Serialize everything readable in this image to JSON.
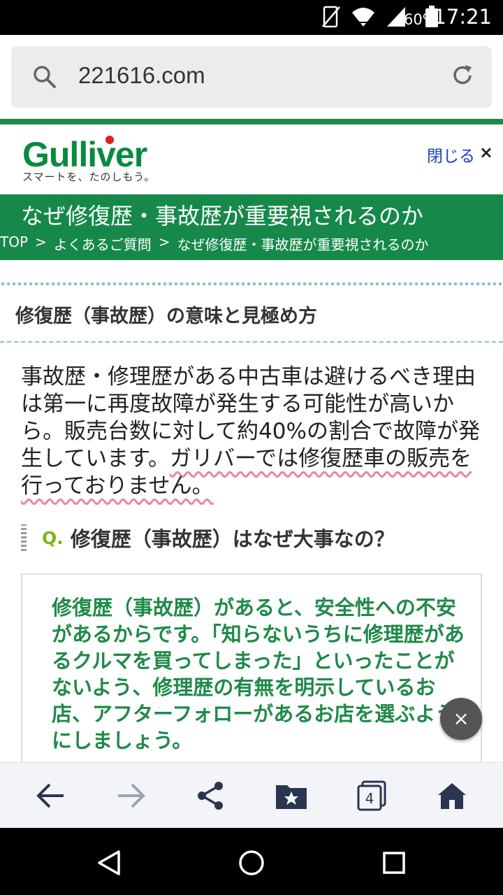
{
  "status_bar": {
    "battery": "60%",
    "time": "17:21"
  },
  "url_bar": {
    "url": "221616.com"
  },
  "site_header": {
    "logo": "Gulliver",
    "tagline": "スマートを、たのしもう。",
    "close_label": "閉じる",
    "close_symbol": "×"
  },
  "title_band": {
    "title": "なぜ修復歴・事故歴が重要視されるのか",
    "breadcrumb": [
      "TOP",
      ">",
      "よくあるご質問",
      ">",
      "なぜ修復歴・事故歴が重要視されるのか"
    ]
  },
  "section": {
    "heading": "修復歴（事故歴）の意味と見極め方",
    "body_plain": "事故歴・修理歴がある中古車は避けるべき理由は第一に再度故障が発生する可能性が高いから。販売台数に対して約40%の割合で故障が発生しています。",
    "body_highlight": "ガリバーでは修復歴車の販売を行っておりません。"
  },
  "faq": {
    "q_mark": "Q.",
    "question": "修復歴（事故歴）はなぜ大事なの？",
    "answer": "修復歴（事故歴）があると、安全性への不安があるからです。「知らないうちに修理歴があるクルマを買ってしまった」といったことがないよう、修理歴の有無を明示しているお店、アフターフォローがあるお店を選ぶようにしましょう。"
  },
  "fab": {
    "symbol": "×"
  },
  "toolbar": {
    "tab_count": "4"
  }
}
